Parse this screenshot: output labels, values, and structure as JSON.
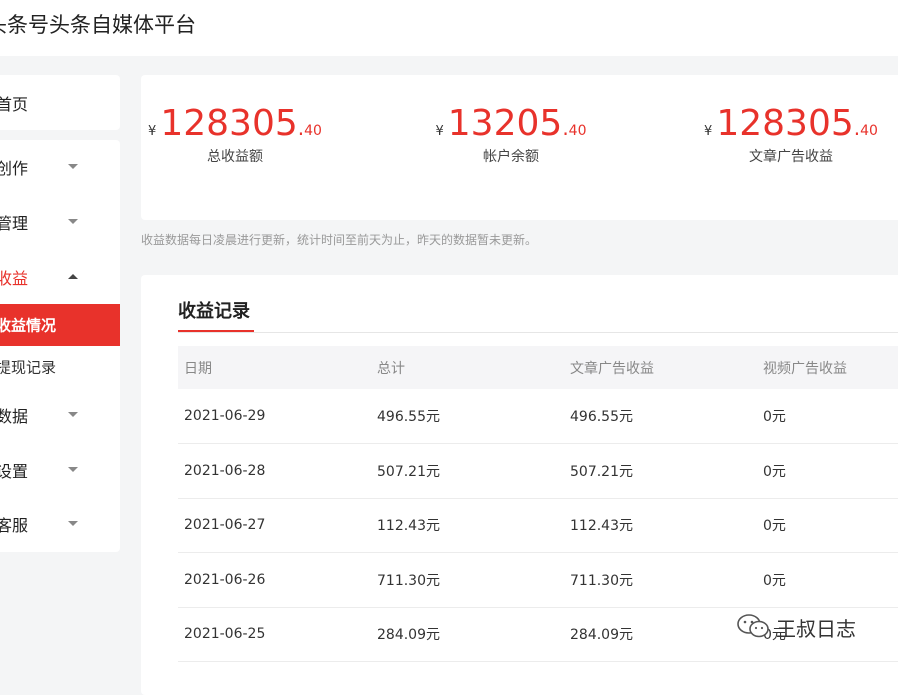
{
  "header": {
    "app_title": "头条号头条自媒体平台"
  },
  "sidebar": {
    "home": "首页",
    "items": [
      {
        "label": "创作",
        "expanded": false
      },
      {
        "label": "管理",
        "expanded": false
      },
      {
        "label": "收益",
        "expanded": true,
        "children": [
          "收益情况",
          "提现记录"
        ],
        "active_child": "收益情况"
      },
      {
        "label": "数据",
        "expanded": false
      },
      {
        "label": "设置",
        "expanded": false
      },
      {
        "label": "客服",
        "expanded": false
      }
    ]
  },
  "stats": [
    {
      "currency": "¥",
      "int": "128305",
      "dot": ".",
      "dec": "40",
      "caption": "总收益额"
    },
    {
      "currency": "¥",
      "int": "13205",
      "dot": ".",
      "dec": "40",
      "caption": "帐户余额"
    },
    {
      "currency": "¥",
      "int": "128305",
      "dot": ".",
      "dec": "40",
      "caption": "文章广告收益"
    }
  ],
  "note": "收益数据每日凌晨进行更新，统计时间至前天为止，昨天的数据暂未更新。",
  "records": {
    "title": "收益记录",
    "columns": [
      "日期",
      "总计",
      "文章广告收益",
      "视频广告收益"
    ],
    "rows": [
      [
        "2021-06-29",
        "496.55元",
        "496.55元",
        "0元"
      ],
      [
        "2021-06-28",
        "507.21元",
        "507.21元",
        "0元"
      ],
      [
        "2021-06-27",
        "112.43元",
        "112.43元",
        "0元"
      ],
      [
        "2021-06-26",
        "711.30元",
        "711.30元",
        "0元"
      ],
      [
        "2021-06-25",
        "284.09元",
        "284.09元",
        "0元"
      ]
    ]
  },
  "watermark": {
    "text": "王叔日志",
    "icon": "wechat-icon"
  },
  "colors": {
    "accent": "#e8322b",
    "background": "#f4f5f6",
    "card": "#ffffff"
  }
}
